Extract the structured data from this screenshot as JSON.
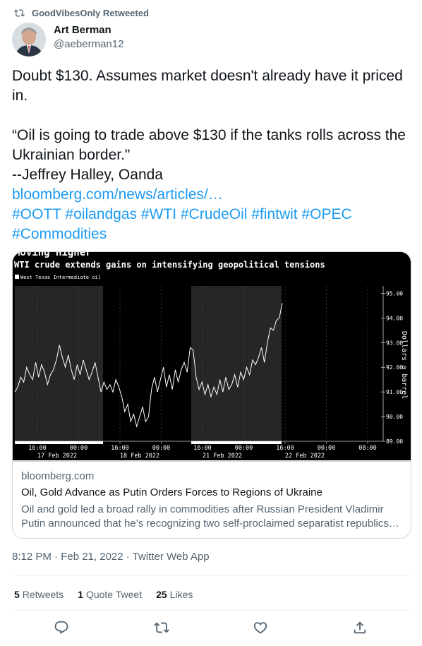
{
  "retweet_banner": {
    "text": "GoodVibesOnly Retweeted"
  },
  "author": {
    "name": "Art Berman",
    "handle": "@aeberman12"
  },
  "tweet": {
    "line1": "Doubt $130. Assumes market doesn't already have it priced in.",
    "quote": "“Oil is going to trade above $130 if the tanks rolls across the Ukrainian border.\"",
    "attribution": "--Jeffrey Halley, Oanda",
    "link": "bloomberg.com/news/articles/…",
    "hashtags": "#OOTT #oilandgas #WTI #CrudeOil #fintwit #OPEC #Commodities"
  },
  "card": {
    "domain": "bloomberg.com",
    "title": "Oil, Gold Advance as Putin Orders Forces to Regions of Ukraine",
    "description": "Oil and gold led a broad rally in commodities after Russian President Vladimir Putin announced that he’s recognizing two self-proclaimed separatist republics…"
  },
  "chart_data": {
    "type": "line",
    "title": "Moving Higher",
    "subtitle": "WTI crude extends gains on intensifying geopolitical tensions",
    "legend": "West Texas Intermediate oil",
    "ylabel": "Dollars a barrel",
    "ylim": [
      89,
      95.3
    ],
    "yticks": [
      "95.00",
      "94.00",
      "93.00",
      "92.00",
      "91.00",
      "90.00",
      "89.00"
    ],
    "xticks": [
      {
        "time": "16:00",
        "date": "17 Feb 2022"
      },
      {
        "time": "00:00",
        "date": ""
      },
      {
        "time": "16:00",
        "date": "18 Feb 2022"
      },
      {
        "time": "00:00",
        "date": ""
      },
      {
        "time": "16:00",
        "date": "21 Feb 2022"
      },
      {
        "time": "00:00",
        "date": ""
      },
      {
        "time": "16:00",
        "date": "22 Feb 2022"
      },
      {
        "time": "00:00",
        "date": ""
      },
      {
        "time": "08:00",
        "date": ""
      }
    ],
    "series": [
      {
        "name": "West Texas Intermediate oil",
        "values": [
          91.0,
          91.2,
          91.6,
          91.4,
          92.0,
          91.7,
          91.5,
          92.2,
          91.6,
          92.1,
          91.8,
          91.3,
          91.7,
          91.9,
          92.3,
          92.9,
          92.4,
          92.0,
          92.5,
          91.9,
          91.5,
          92.1,
          91.7,
          92.3,
          91.9,
          91.5,
          91.8,
          92.2,
          91.6,
          91.0,
          91.4,
          91.1,
          91.3,
          91.0,
          91.5,
          91.2,
          90.8,
          90.2,
          90.5,
          89.8,
          90.1,
          89.6,
          90.0,
          90.4,
          89.8,
          90.0,
          91.1,
          91.6,
          91.0,
          91.5,
          92.0,
          91.2,
          91.7,
          91.1,
          91.9,
          91.4,
          91.9,
          92.2,
          91.8,
          92.8,
          92.7,
          91.6,
          91.1,
          91.4,
          90.9,
          91.3,
          90.8,
          91.2,
          90.9,
          91.5,
          91.0,
          91.6,
          91.1,
          91.3,
          91.7,
          91.2,
          91.8,
          91.5,
          92.0,
          91.7,
          92.3,
          92.1,
          92.4,
          92.8,
          92.2,
          93.0,
          93.6,
          93.5,
          93.9,
          94.0,
          94.6
        ]
      }
    ]
  },
  "timestamp": "8:12 PM · Feb 21, 2022 · Twitter Web App",
  "stats": {
    "retweets_count": "5",
    "retweets_label": "Retweets",
    "quotes_count": "1",
    "quotes_label": "Quote Tweet",
    "likes_count": "25",
    "likes_label": "Likes"
  },
  "colors": {
    "link": "#1d9bf0",
    "muted": "#536471"
  },
  "icons": [
    "retweet-icon",
    "reply-icon",
    "like-icon",
    "share-icon"
  ]
}
